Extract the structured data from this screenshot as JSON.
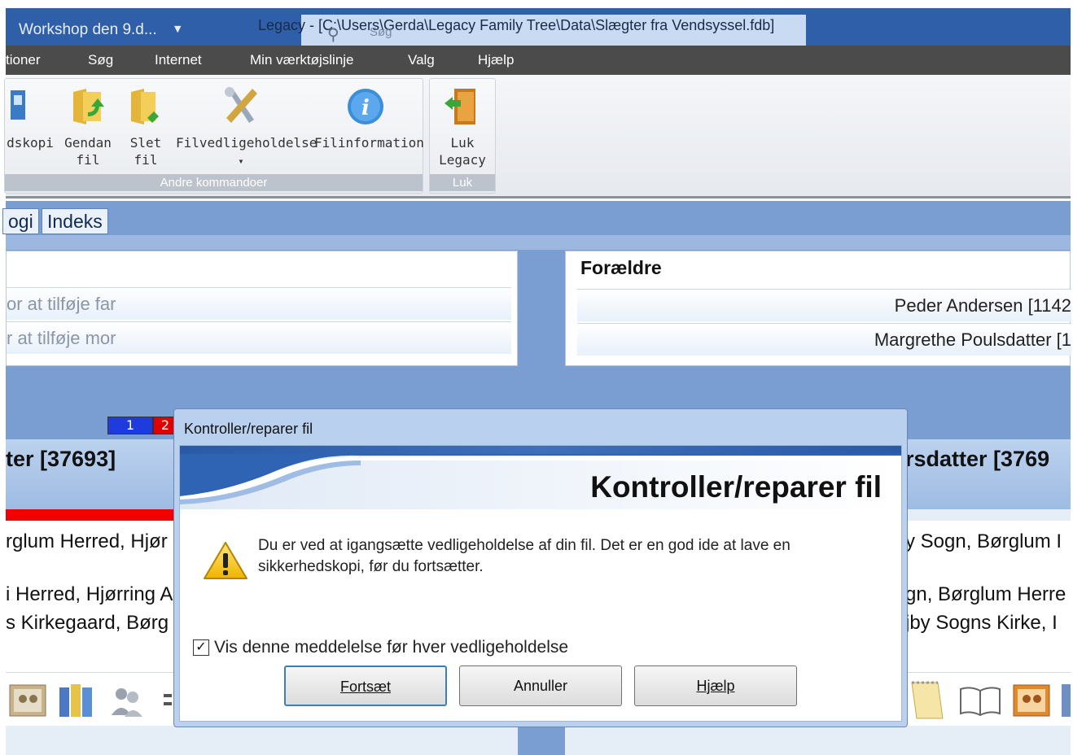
{
  "titlebar": {
    "workshop": "Workshop den 9.d...",
    "title": "Legacy - [C:\\Users\\Gerda\\Legacy Family Tree\\Data\\Slægter fra Vendsyssel.fdb]",
    "search_label": "Søg"
  },
  "menu": [
    "tioner",
    "Søg",
    "Internet",
    "Min værktøjslinje",
    "Valg",
    "Hjælp"
  ],
  "ribbon": {
    "groups": [
      {
        "label": "Andre kommandoer",
        "buttons": [
          {
            "line1": "dskopi",
            "line2": ""
          },
          {
            "line1": "Gendan",
            "line2": "fil"
          },
          {
            "line1": "Slet",
            "line2": "fil"
          },
          {
            "line1": "Filvedligeholdelse",
            "line2": "▾"
          },
          {
            "line1": "Filinformation",
            "line2": ""
          }
        ]
      },
      {
        "label": "Luk",
        "buttons": [
          {
            "line1": "Luk",
            "line2": "Legacy"
          }
        ]
      }
    ]
  },
  "tabs": [
    "ogi",
    "Indeks"
  ],
  "left_panel": {
    "rows": [
      "or at tilføje far",
      "r at tilføje mor"
    ]
  },
  "right_panel": {
    "heading": "Forældre",
    "rows": [
      "Peder Andersen [1142",
      "Margrethe Poulsdatter [1"
    ]
  },
  "badges": [
    {
      "label": "1",
      "color": "#1e3bdb"
    },
    {
      "label": "2",
      "color": "#e00000"
    }
  ],
  "left_person": {
    "name": "ter [37693]",
    "places": [
      "rglum Herred, Hjør",
      "i Herred, Hjørring A",
      "s Kirkegaard, Børg"
    ]
  },
  "right_person": {
    "name": "rsdatter [3769",
    "places": [
      "y Sogn, Børglum I",
      "gn, Børglum Herre",
      "jby Sogns Kirke, I"
    ]
  },
  "dialog": {
    "title": "Kontroller/reparer fil",
    "heading": "Kontroller/reparer fil",
    "message": "Du er ved at igangsætte vedligeholdelse af din fil.  Det er en god ide at lave en sikkerhedskopi, før du fortsætter.",
    "checkbox_label": "Vis denne meddelelse før hver vedligeholdelse",
    "checkbox_checked": true,
    "buttons": {
      "continue": "Fortsæt",
      "cancel": "Annuller",
      "help": "Hjælp"
    }
  }
}
